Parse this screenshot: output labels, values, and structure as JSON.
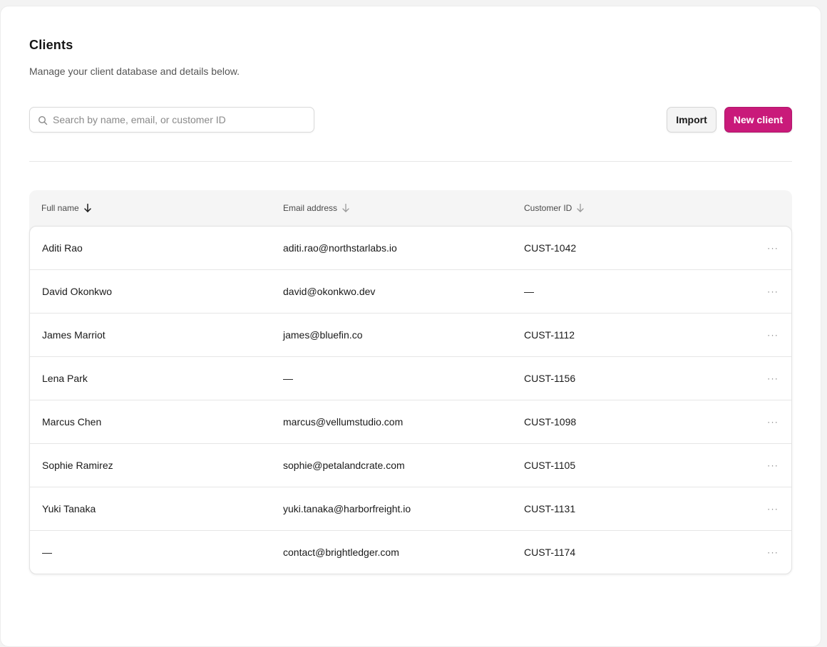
{
  "header": {
    "title": "Clients",
    "subtitle": "Manage your client database and details below."
  },
  "search": {
    "placeholder": "Search by name, email, or customer ID",
    "value": ""
  },
  "actions": {
    "import_label": "Import",
    "new_label": "New client"
  },
  "table": {
    "columns": [
      {
        "label": "Full name",
        "sort": "active-desc"
      },
      {
        "label": "Email address",
        "sort": "inactive"
      },
      {
        "label": "Customer ID",
        "sort": "inactive"
      }
    ],
    "rows": [
      {
        "name": "Aditi Rao",
        "email": "aditi.rao@northstarlabs.io",
        "customer_id": "CUST-1042"
      },
      {
        "name": "David Okonkwo",
        "email": "david@okonkwo.dev",
        "customer_id": "—"
      },
      {
        "name": "James Marriot",
        "email": "james@bluefin.co",
        "customer_id": "CUST-1112"
      },
      {
        "name": "Lena Park",
        "email": "—",
        "customer_id": "CUST-1156"
      },
      {
        "name": "Marcus Chen",
        "email": "marcus@vellumstudio.com",
        "customer_id": "CUST-1098"
      },
      {
        "name": "Sophie Ramirez",
        "email": "sophie@petalandcrate.com",
        "customer_id": "CUST-1105"
      },
      {
        "name": "Yuki Tanaka",
        "email": "yuki.tanaka@harborfreight.io",
        "customer_id": "CUST-1131"
      },
      {
        "name": "—",
        "email": "contact@brightledger.com",
        "customer_id": "CUST-1174"
      }
    ],
    "row_menu_label": "···"
  },
  "colors": {
    "accent": "#c91a7a",
    "text": "#1a1a1a",
    "muted": "#555555"
  },
  "icons": {
    "search": "search-icon",
    "sort_active": "arrow-down-icon",
    "sort_inactive": "arrow-down-icon",
    "row_menu": "more-horizontal-icon"
  }
}
